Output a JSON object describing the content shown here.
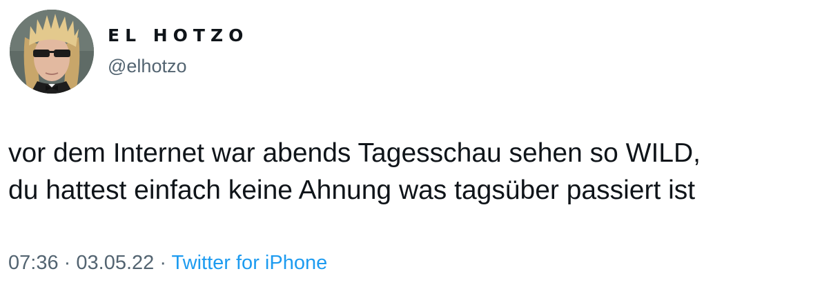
{
  "author": {
    "display_name": "EL HOTZO",
    "handle": "@elhotzo"
  },
  "tweet": {
    "text_lines": [
      "vor dem Internet war abends Tagesschau sehen so WILD,",
      "du hattest einfach keine Ahnung was tagsüber passiert ist"
    ]
  },
  "meta": {
    "time": "07:36",
    "separator": "·",
    "date": "03.05.22",
    "source": "Twitter for iPhone"
  },
  "colors": {
    "text": "#0f1419",
    "secondary": "#536471",
    "link": "#1d9bf0",
    "background": "#ffffff"
  }
}
